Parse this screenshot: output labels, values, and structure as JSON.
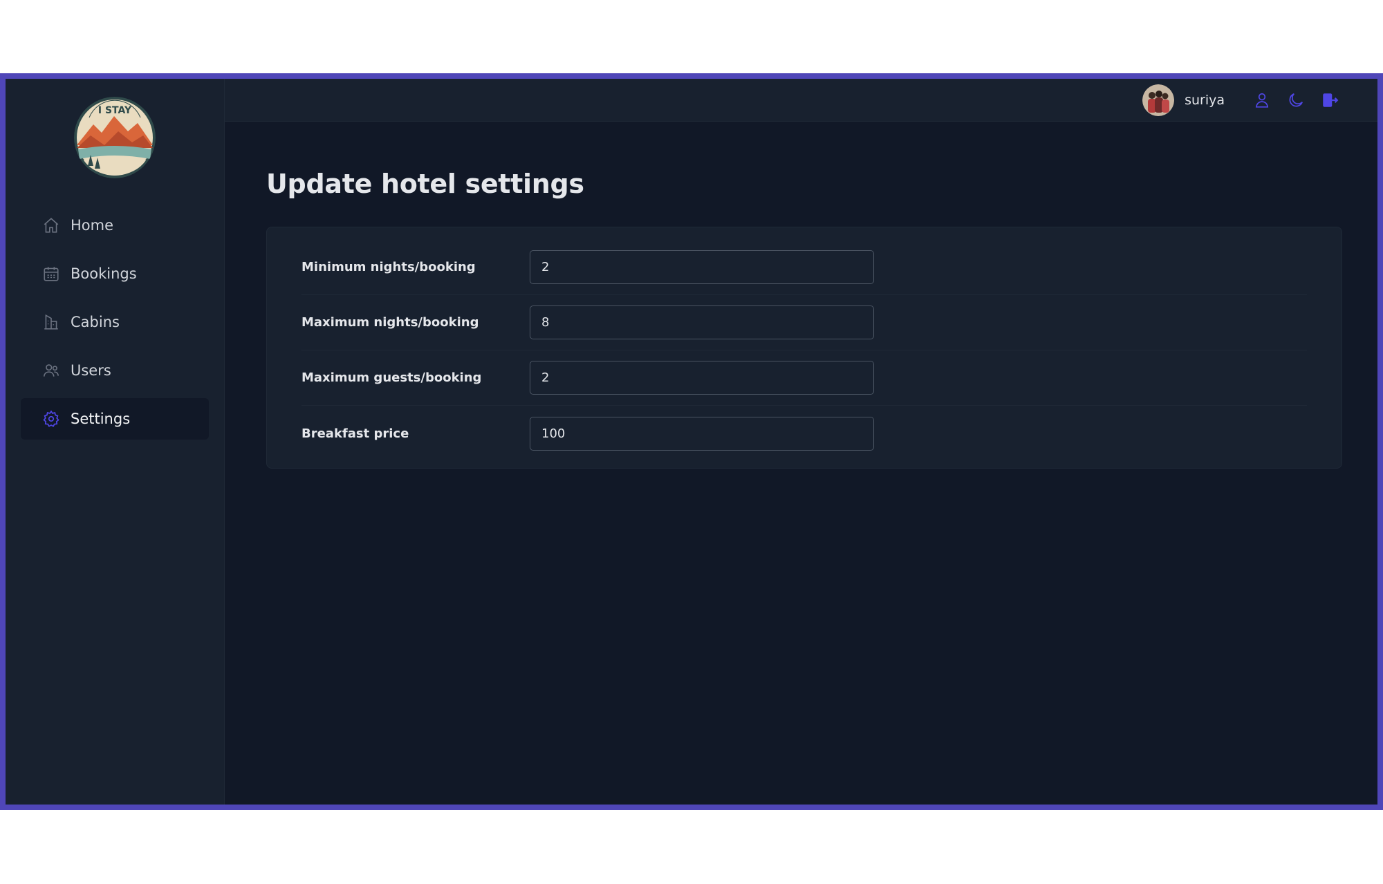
{
  "sidebar": {
    "logo_text": "I STAY",
    "items": [
      {
        "label": "Home",
        "icon": "home-icon"
      },
      {
        "label": "Bookings",
        "icon": "calendar-icon"
      },
      {
        "label": "Cabins",
        "icon": "building-icon"
      },
      {
        "label": "Users",
        "icon": "users-icon"
      },
      {
        "label": "Settings",
        "icon": "gear-icon",
        "active": true
      }
    ]
  },
  "header": {
    "username": "suriya",
    "icons": [
      "user-icon",
      "moon-icon",
      "logout-icon"
    ]
  },
  "main": {
    "title": "Update hotel settings",
    "fields": [
      {
        "label": "Minimum nights/booking",
        "value": "2"
      },
      {
        "label": "Maximum nights/booking",
        "value": "8"
      },
      {
        "label": "Maximum guests/booking",
        "value": "2"
      },
      {
        "label": "Breakfast price",
        "value": "100"
      }
    ]
  },
  "colors": {
    "accent": "#4f46e5",
    "frame": "#4f46b8",
    "background": "#111827",
    "surface": "#18212f"
  }
}
